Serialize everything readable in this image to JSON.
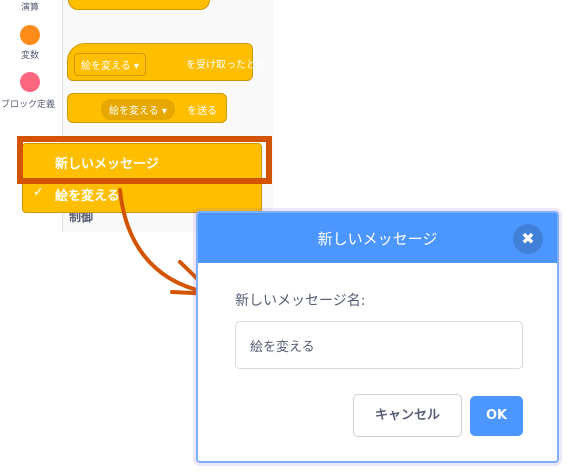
{
  "sidebar": {
    "items": [
      {
        "label": "演算",
        "color": "#59c059"
      },
      {
        "label": "変数",
        "color": "#ff8c1a"
      },
      {
        "label": "ブロック定義",
        "color": "#ff6680"
      }
    ]
  },
  "palette": {
    "block_when_received_dropdown": "絵を変える ▾",
    "block_when_received_label": "を受け取ったとき",
    "block_broadcast_dropdown": "絵を変える ▾",
    "block_broadcast_label": "を送る",
    "partial_label": "制御"
  },
  "menu": {
    "new_message": "新しいメッセージ",
    "check_mark": "✓",
    "selected_item": "絵を変える"
  },
  "modal": {
    "title": "新しいメッセージ",
    "close_icon": "✖",
    "field_label": "新しいメッセージ名:",
    "field_value": "絵を変える",
    "cancel_label": "キャンセル",
    "ok_label": "OK"
  }
}
